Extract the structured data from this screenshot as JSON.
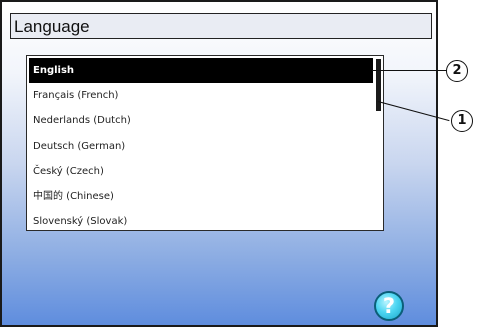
{
  "window": {
    "title": "Language"
  },
  "language_list": {
    "items": [
      {
        "label": "English",
        "selected": true
      },
      {
        "label": "Français (French)",
        "selected": false
      },
      {
        "label": "Nederlands (Dutch)",
        "selected": false
      },
      {
        "label": "Deutsch (German)",
        "selected": false
      },
      {
        "label": "Český (Czech)",
        "selected": false
      },
      {
        "label": "中国的 (Chinese)",
        "selected": false
      },
      {
        "label": "Slovenský (Slovak)",
        "selected": false
      }
    ]
  },
  "help_button": {
    "icon": "question-mark-icon",
    "label": "?"
  },
  "callouts": [
    {
      "number": "2"
    },
    {
      "number": "1"
    }
  ],
  "colors": {
    "selection_bg": "#000000",
    "selection_text": "#ffffff",
    "help_accent": "#1aa7cb"
  }
}
